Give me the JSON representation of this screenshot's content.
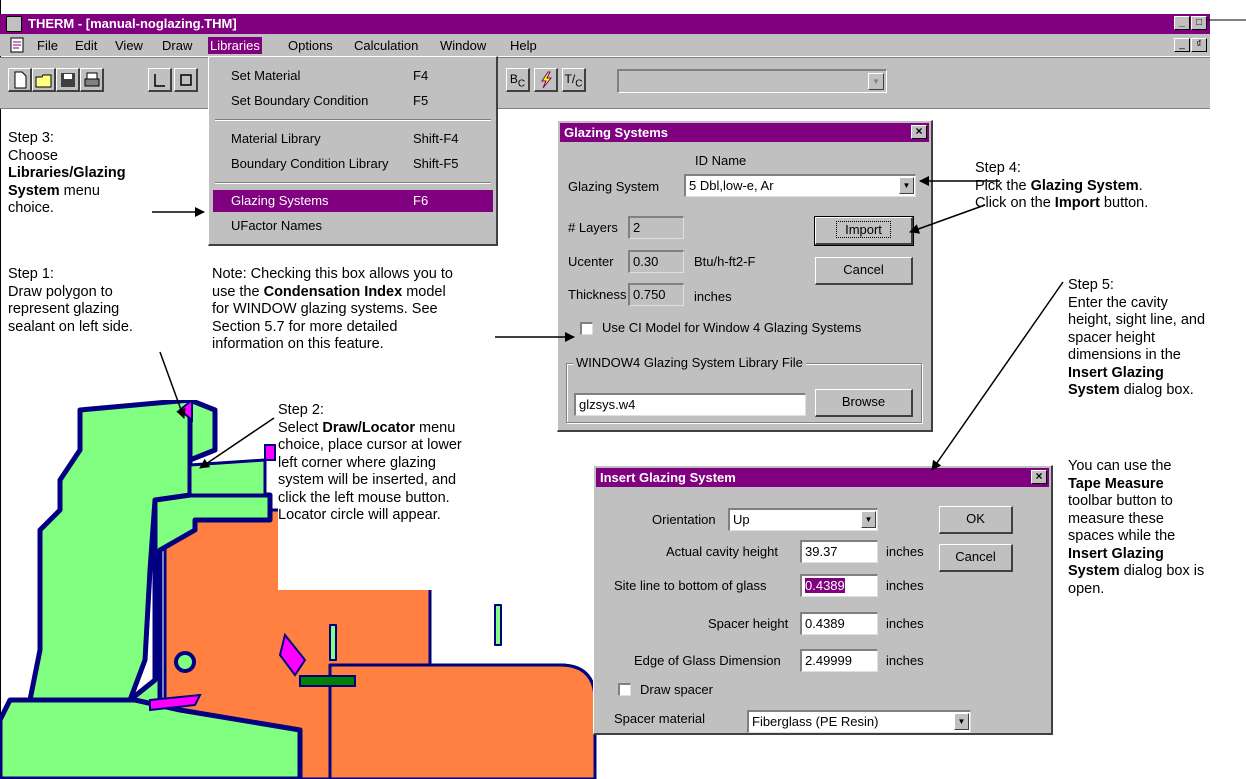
{
  "app": {
    "title": "THERM - [manual-noglazing.THM]",
    "minimize": "_",
    "maximize": "□",
    "restore": "₫"
  },
  "menubar": {
    "items": [
      "File",
      "Edit",
      "View",
      "Draw",
      "Libraries",
      "Options",
      "Calculation",
      "Window",
      "Help"
    ],
    "active": "Libraries"
  },
  "libraries_menu": {
    "items": [
      {
        "label": "Set Material",
        "shortcut": "F4"
      },
      {
        "label": "Set Boundary Condition",
        "shortcut": "F5"
      },
      {
        "label": "Material Library",
        "shortcut": "Shift-F4"
      },
      {
        "label": "Boundary Condition Library",
        "shortcut": "Shift-F5"
      },
      {
        "label": "Glazing Systems",
        "shortcut": "F6"
      },
      {
        "label": "UFactor Names",
        "shortcut": ""
      }
    ],
    "highlighted": "Glazing Systems"
  },
  "toolbar": {
    "buttons": [
      "new-icon",
      "open-icon",
      "save-icon",
      "print-icon",
      "locator-icon",
      "rectangle-icon",
      "boundary-condition-icon",
      "calculate-icon",
      "temperature-condition-icon"
    ],
    "bc_label": "B",
    "bc_sub": "C",
    "tc_label": "T",
    "tc_sub": "C",
    "combo_value": ""
  },
  "glazing_dialog": {
    "title": "Glazing Systems",
    "id_name_header": "ID Name",
    "system_label": "Glazing System",
    "system_value": "5 Dbl,low-e, Ar",
    "layers_label": "# Layers",
    "layers_value": "2",
    "ucenter_label": "Ucenter",
    "ucenter_value": "0.30",
    "ucenter_unit": "Btu/h-ft2-F",
    "thickness_label": "Thickness",
    "thickness_value": "0.750",
    "thickness_unit": "inches",
    "import_button": "Import",
    "cancel_button": "Cancel",
    "ci_checkbox": "Use CI Model for Window 4 Glazing Systems",
    "library_group": "WINDOW4 Glazing System Library File",
    "library_file": "glzsys.w4",
    "browse_button": "Browse",
    "close": "×"
  },
  "insert_dialog": {
    "title": "Insert Glazing System",
    "orientation_label": "Orientation",
    "orientation_value": "Up",
    "cavity_label": "Actual cavity height",
    "cavity_value": "39.37",
    "sightline_label": "Site line to bottom of glass",
    "sightline_value": "0.4389",
    "spacer_label": "Spacer height",
    "spacer_value": "0.4389",
    "edge_label": "Edge of Glass Dimension",
    "edge_value": "2.49999",
    "unit": "inches",
    "ok_button": "OK",
    "cancel_button": "Cancel",
    "draw_spacer": "Draw spacer",
    "spacer_material_label": "Spacer material",
    "spacer_material_value": "Fiberglass (PE Resin)",
    "close": "×"
  },
  "annotations": {
    "step3": {
      "line1": "Step 3:",
      "line2": "Choose",
      "bold1": "Libraries/Glazing",
      "bold2": "System",
      "rest2": " menu",
      "line5": "choice."
    },
    "step1": {
      "line1": "Step 1:",
      "line2": "Draw polygon to",
      "line3": "represent glazing",
      "line4": "sealant on left side."
    },
    "note": {
      "line1": "Note: Checking this box allows you to",
      "pre2": "use the ",
      "bold2": "Condensation Index",
      "post2": " model",
      "line3": "for WINDOW glazing systems. See",
      "line4": "Section 5.7 for more detailed",
      "line5": "information on this feature."
    },
    "step2": {
      "line1": "Step 2:",
      "pre2": "Select ",
      "bold2": "Draw/Locator",
      "post2": " menu",
      "line3": "choice, place cursor at lower",
      "line4": "left corner where glazing",
      "line5": "system will be inserted, and",
      "line6": "click the left mouse button.",
      "line7": "Locator circle will appear."
    },
    "step4": {
      "line1": "Step 4:",
      "pre2": "Pick the ",
      "bold2": "Glazing System",
      "post2": ".",
      "pre3": "Click on the ",
      "bold3": "Import",
      "post3": " button."
    },
    "step5": {
      "line1": "Step 5:",
      "line2": "Enter the cavity",
      "line3": "height, sight line, and",
      "line4": "spacer height",
      "line5": "dimensions in the",
      "bold6": "Insert Glazing",
      "bold7": "System",
      "post7": " dialog box."
    },
    "tape": {
      "line1": "You can use the",
      "bold2": "Tape Measure",
      "line3": "toolbar button to",
      "line4": "measure these",
      "line5": "spaces while the",
      "bold6": "Insert Glazing",
      "bold7": "System",
      "post7": " dialog box is",
      "line8": "open."
    }
  },
  "colors": {
    "titlebar": "#800080",
    "face": "#c0c0c0",
    "frame_green": "#80ff80",
    "frame_orange": "#ff8040",
    "outline_navy": "#000080",
    "sealant_magenta": "#ff00ff"
  }
}
